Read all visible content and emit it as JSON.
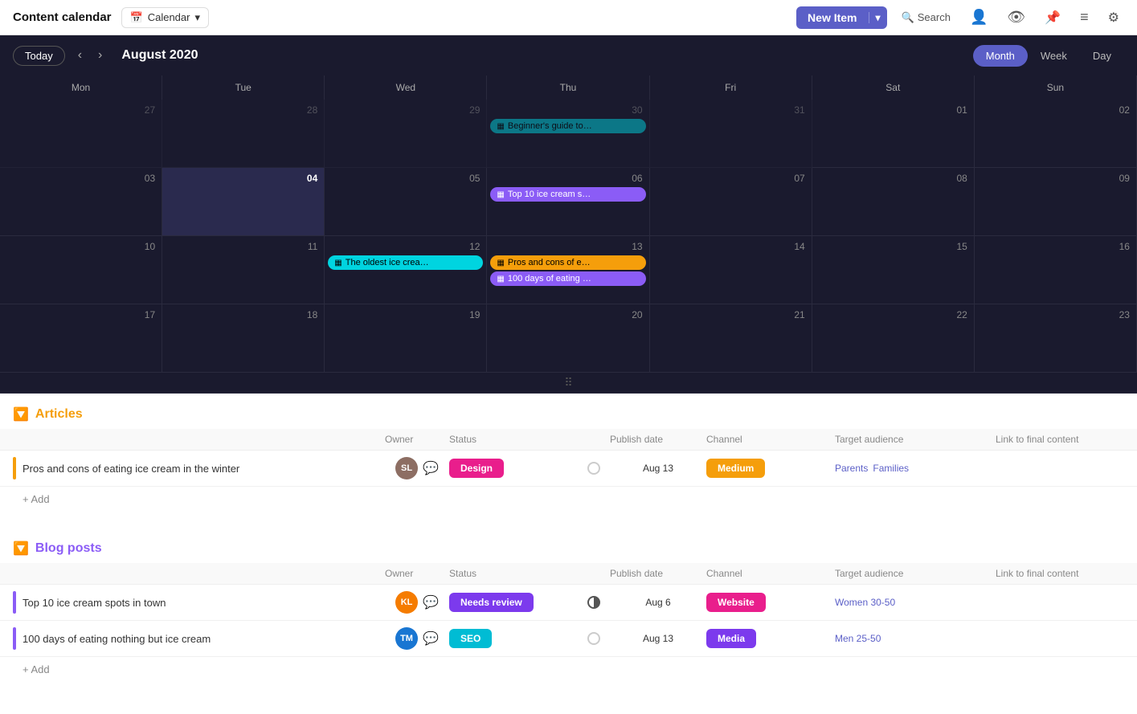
{
  "app": {
    "title": "Content calendar",
    "calendar_label": "Calendar",
    "new_item_label": "New Item",
    "search_label": "Search"
  },
  "toolbar": {
    "today_label": "Today",
    "month_title": "August 2020",
    "views": [
      "Month",
      "Week",
      "Day"
    ],
    "active_view": "Month",
    "days_of_week": [
      "Mon",
      "Tue",
      "Wed",
      "Thu",
      "Fri",
      "Sat",
      "Sun"
    ]
  },
  "calendar": {
    "weeks": [
      {
        "days": [
          {
            "date": "27",
            "outside": true,
            "events": []
          },
          {
            "date": "28",
            "outside": true,
            "events": []
          },
          {
            "date": "29",
            "outside": true,
            "events": []
          },
          {
            "date": "30",
            "outside": true,
            "events": [
              {
                "label": "Beginner's guide to…",
                "color": "cyan"
              }
            ]
          },
          {
            "date": "31",
            "outside": true,
            "events": []
          },
          {
            "date": "01",
            "outside": false,
            "events": []
          },
          {
            "date": "02",
            "outside": false,
            "events": []
          }
        ]
      },
      {
        "days": [
          {
            "date": "03",
            "outside": false,
            "events": []
          },
          {
            "date": "04",
            "outside": false,
            "today": true,
            "events": []
          },
          {
            "date": "05",
            "outside": false,
            "events": []
          },
          {
            "date": "06",
            "outside": false,
            "events": [
              {
                "label": "Top 10 ice cream s…",
                "color": "purple"
              }
            ]
          },
          {
            "date": "07",
            "outside": false,
            "events": []
          },
          {
            "date": "08",
            "outside": false,
            "events": []
          },
          {
            "date": "09",
            "outside": false,
            "events": []
          }
        ]
      },
      {
        "days": [
          {
            "date": "10",
            "outside": false,
            "events": []
          },
          {
            "date": "11",
            "outside": false,
            "events": []
          },
          {
            "date": "12",
            "outside": false,
            "events": [
              {
                "label": "The oldest ice crea…",
                "color": "cyan"
              }
            ]
          },
          {
            "date": "13",
            "outside": false,
            "events": [
              {
                "label": "Pros and cons of e…",
                "color": "orange"
              },
              {
                "label": "100 days of eating …",
                "color": "purple"
              }
            ]
          },
          {
            "date": "14",
            "outside": false,
            "events": []
          },
          {
            "date": "15",
            "outside": false,
            "events": []
          },
          {
            "date": "16",
            "outside": false,
            "events": []
          }
        ]
      },
      {
        "days": [
          {
            "date": "17",
            "outside": false,
            "events": []
          },
          {
            "date": "18",
            "outside": false,
            "events": []
          },
          {
            "date": "19",
            "outside": false,
            "events": []
          },
          {
            "date": "20",
            "outside": false,
            "events": []
          },
          {
            "date": "21",
            "outside": false,
            "events": []
          },
          {
            "date": "22",
            "outside": false,
            "events": []
          },
          {
            "date": "23",
            "outside": false,
            "events": []
          }
        ]
      }
    ]
  },
  "articles": {
    "section_title": "Articles",
    "columns": {
      "owner": "Owner",
      "status": "Status",
      "publish_date": "Publish date",
      "channel": "Channel",
      "target_audience": "Target audience",
      "link": "Link to final content"
    },
    "rows": [
      {
        "title": "Pros and cons of eating ice cream in the winter",
        "owner_initials": "SL",
        "owner_color": "brown",
        "status": "Design",
        "status_class": "design",
        "publish_date": "Aug 13",
        "channel": "Medium",
        "channel_class": "medium",
        "audience": [
          "Parents",
          "Families"
        ],
        "accent": "orange"
      }
    ],
    "add_label": "+ Add"
  },
  "blog_posts": {
    "section_title": "Blog posts",
    "columns": {
      "owner": "Owner",
      "status": "Status",
      "publish_date": "Publish date",
      "channel": "Channel",
      "target_audience": "Target audience",
      "link": "Link to final content"
    },
    "rows": [
      {
        "title": "Top 10 ice cream spots in town",
        "owner_initials": "KL",
        "owner_color": "orange-av",
        "status": "Needs review",
        "status_class": "needs-review",
        "publish_date": "Aug 6",
        "channel": "Website",
        "channel_class": "website",
        "audience": [
          "Women 30-50"
        ],
        "accent": "purple",
        "radio_half": true
      },
      {
        "title": "100 days of eating nothing but ice cream",
        "owner_initials": "TM",
        "owner_color": "blue",
        "status": "SEO",
        "status_class": "seo",
        "publish_date": "Aug 13",
        "channel": "Media",
        "channel_class": "media",
        "audience": [
          "Men 25-50"
        ],
        "accent": "purple",
        "radio_half": false
      }
    ],
    "add_label": "+ Add"
  },
  "icons": {
    "calendar": "📅",
    "chevron_down": "▾",
    "chevron_left": "‹",
    "chevron_right": "›",
    "search": "🔍",
    "user": "👤",
    "eye": "👁",
    "pin": "📌",
    "filter": "≡",
    "settings": "⚙",
    "grid_dots": "⠿",
    "bell": "🔔",
    "chat_cyan": "💬",
    "chat_grey": "💬"
  }
}
